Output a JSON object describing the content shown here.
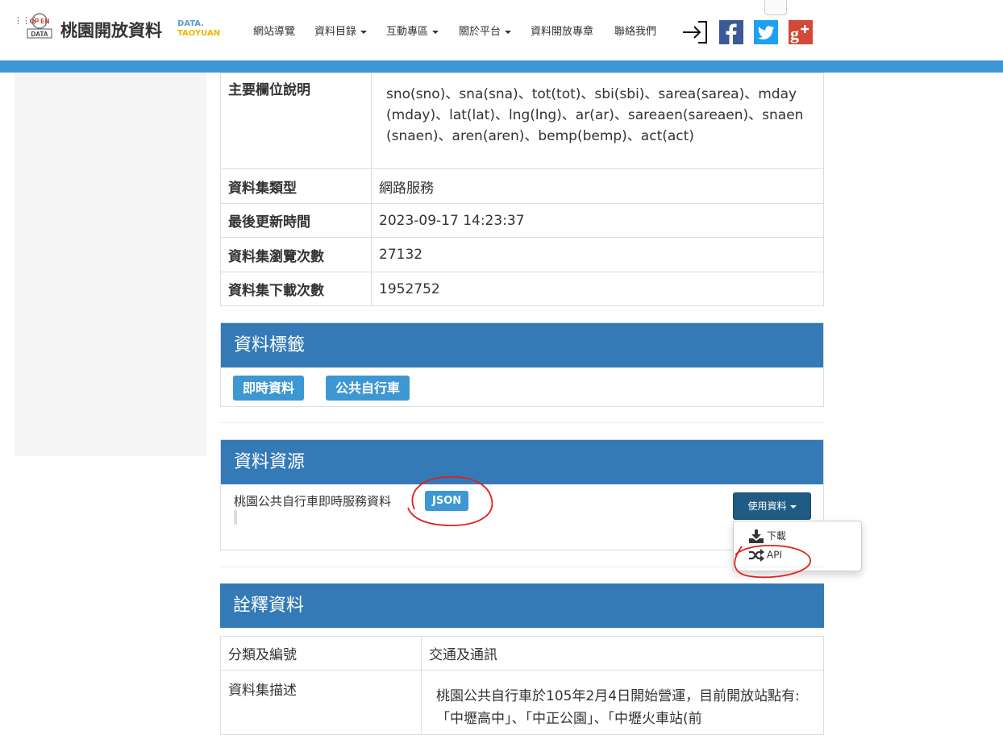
{
  "header": {
    "logo_top": "OP EN",
    "logo_bottom": "DATA",
    "title": "桃園開放資料",
    "sub_line1": "DATA.",
    "sub_line2": "TAOYUAN",
    "menu_icon": "grid-menu-icon",
    "nav": [
      {
        "label": "網站導覽",
        "dropdown": false
      },
      {
        "label": "資料目錄",
        "dropdown": true
      },
      {
        "label": "互動專區",
        "dropdown": true
      },
      {
        "label": "關於平台",
        "dropdown": true
      },
      {
        "label": "資料開放專章",
        "dropdown": false
      },
      {
        "label": "聯絡我們",
        "dropdown": false
      }
    ],
    "social": [
      "login-icon",
      "facebook-icon",
      "twitter-icon",
      "google-plus-icon"
    ],
    "colors": {
      "bar": "#3d97d3",
      "facebook": "#3b5998",
      "twitter": "#1da1f2",
      "google": "#d34836"
    }
  },
  "info_table": [
    {
      "key": "主要欄位說明",
      "value": "sno(sno)、sna(sna)、tot(tot)、sbi(sbi)、sarea(sarea)、mday(mday)、lat(lat)、lng(lng)、ar(ar)、sareaen(sareaen)、snaen(snaen)、aren(aren)、bemp(bemp)、act(act)"
    },
    {
      "key": "資料集類型",
      "value": "網路服務"
    },
    {
      "key": "最後更新時間",
      "value": "2023-09-17 14:23:37"
    },
    {
      "key": "資料集瀏覽次數",
      "value": "27132"
    },
    {
      "key": "資料集下載次數",
      "value": "1952752"
    }
  ],
  "tags_panel": {
    "title": "資料標籤",
    "tags": [
      "即時資料",
      "公共自行車"
    ]
  },
  "resources_panel": {
    "title": "資料資源",
    "resource_name": "桃園公共自行車即時服務資料",
    "format": "JSON",
    "use_button": "使用資料",
    "menu": [
      {
        "label": "下載",
        "icon": "download-icon"
      },
      {
        "label": "API",
        "icon": "shuffle-icon"
      }
    ]
  },
  "meta_panel": {
    "title": "詮釋資料",
    "rows": [
      {
        "key": "分類及編號",
        "value": "交通及通訊"
      },
      {
        "key": "資料集描述",
        "value": "桃園公共自行車於105年2月4日開始營運，目前開放站點有:「中壢高中」、「中正公園」、「中壢火車站(前"
      }
    ]
  },
  "annotation_color": "#e0201e"
}
